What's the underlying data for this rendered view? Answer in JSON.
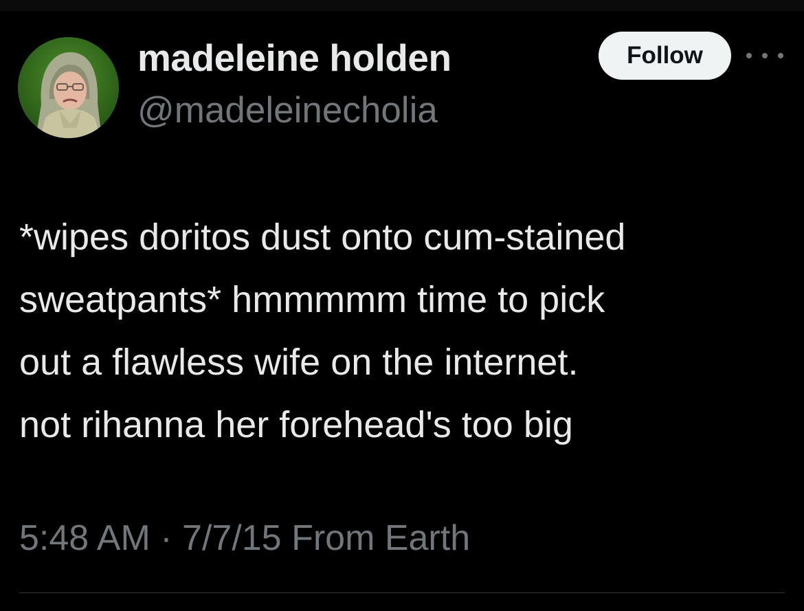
{
  "user": {
    "display_name": "madeleine holden",
    "handle": "@madeleinecholia"
  },
  "actions": {
    "follow_label": "Follow",
    "more_icon": "more-horizontal-icon"
  },
  "tweet": {
    "lines": [
      "*wipes doritos dust onto cum-stained",
      "sweatpants* hmmmmm time to pick",
      "out a flawless wife on the internet.",
      "not rihanna her forehead's too big"
    ],
    "time": "5:48 AM",
    "separator": "·",
    "date": "7/7/15",
    "source": "From Earth"
  },
  "colors": {
    "background": "#000000",
    "text_primary": "#e7e9ea",
    "text_secondary": "#71767b",
    "follow_button_bg": "#eff3f4",
    "follow_button_text": "#0f1419",
    "divider": "#2f3336"
  }
}
